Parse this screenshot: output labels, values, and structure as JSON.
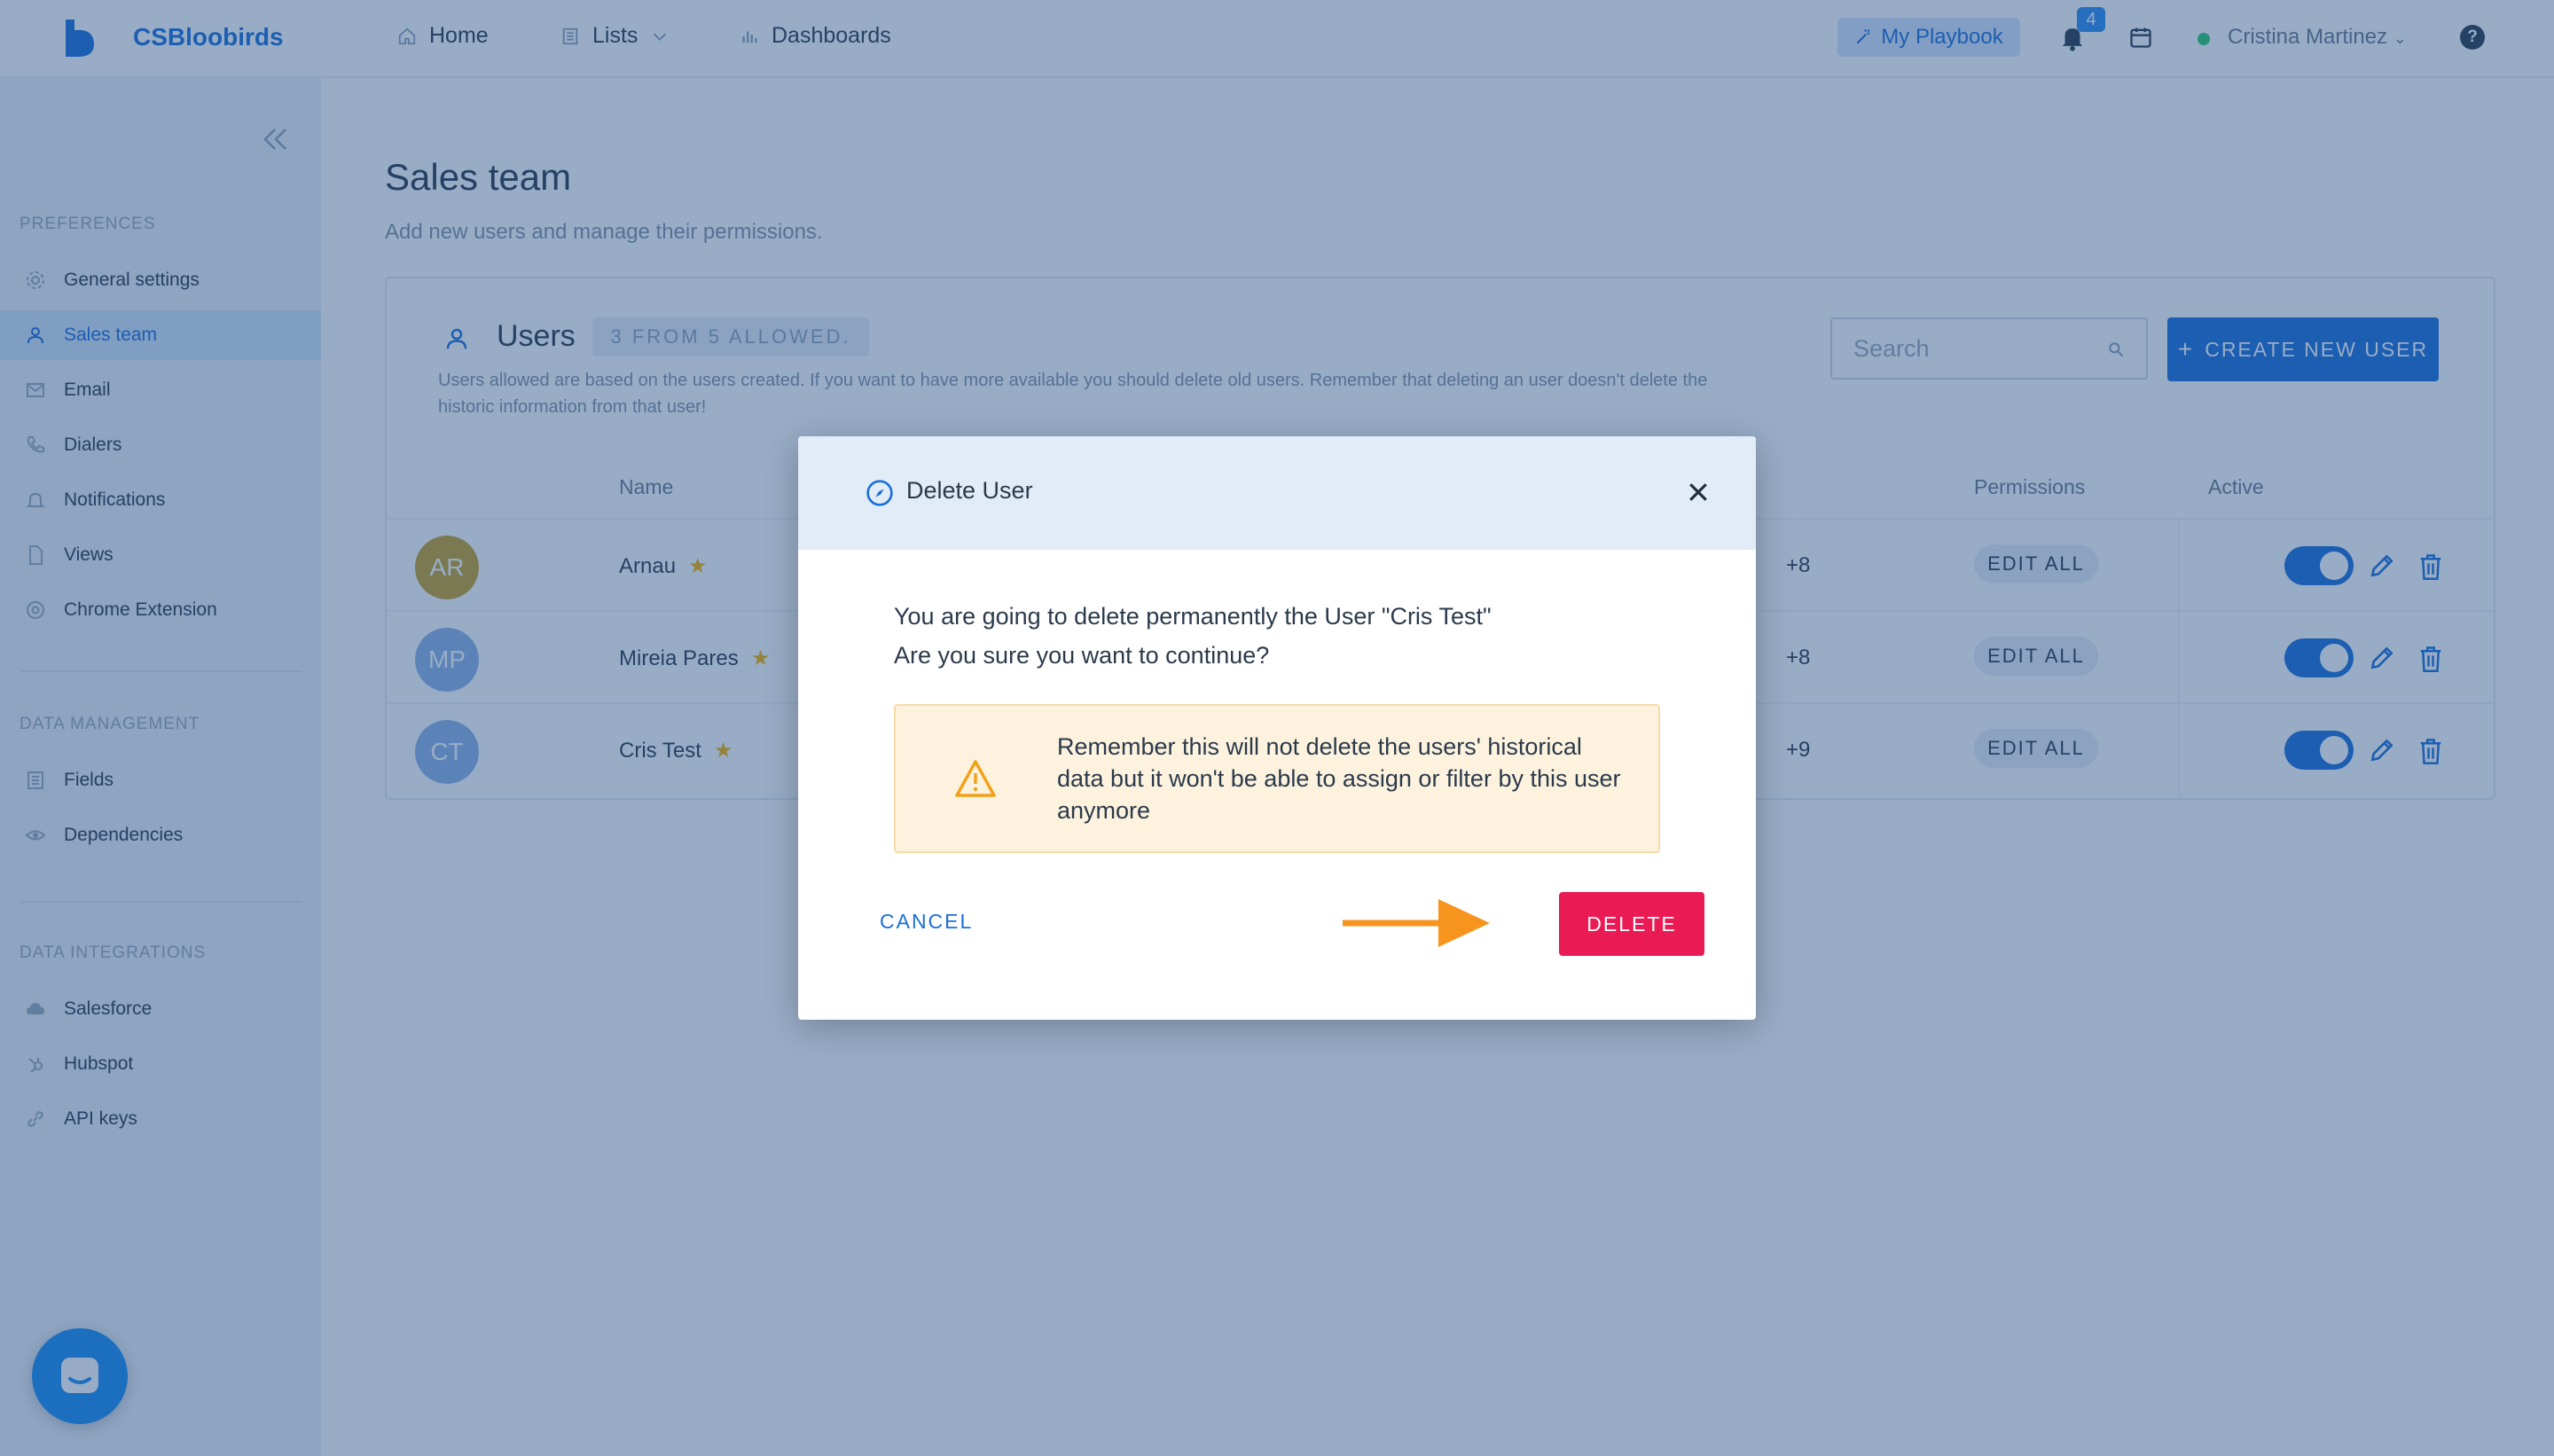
{
  "app": {
    "brand": "CSBloobirds"
  },
  "topnav": {
    "home": "Home",
    "lists": "Lists",
    "dashboards": "Dashboards",
    "playbook": "My Playbook",
    "notifications_count": "4",
    "user_name": "Cristina Martinez",
    "help": "?"
  },
  "sidebar": {
    "preferences_title": "PREFERENCES",
    "preferences": [
      {
        "label": "General settings",
        "icon": "gear-icon"
      },
      {
        "label": "Sales team",
        "icon": "user-icon",
        "active": true
      },
      {
        "label": "Email",
        "icon": "mail-icon"
      },
      {
        "label": "Dialers",
        "icon": "phone-icon"
      },
      {
        "label": "Notifications",
        "icon": "bell-icon"
      },
      {
        "label": "Views",
        "icon": "file-icon"
      },
      {
        "label": "Chrome Extension",
        "icon": "chrome-icon"
      }
    ],
    "data_management_title": "DATA MANAGEMENT",
    "data_management": [
      {
        "label": "Fields",
        "icon": "list-icon"
      },
      {
        "label": "Dependencies",
        "icon": "eye-icon"
      }
    ],
    "data_integrations_title": "DATA INTEGRATIONS",
    "data_integrations": [
      {
        "label": "Salesforce",
        "icon": "cloud-icon"
      },
      {
        "label": "Hubspot",
        "icon": "hubspot-icon"
      },
      {
        "label": "API keys",
        "icon": "link-icon"
      }
    ]
  },
  "page": {
    "title": "Sales team",
    "subtitle": "Add new users and manage their permissions."
  },
  "users": {
    "title": "Users",
    "allowed": "3 FROM 5 ALLOWED.",
    "help_text": "Users allowed are based on the users created. If you want to have more available you should delete old users. Remember that deleting an user doesn't delete the historic information from that user!",
    "search_placeholder": "Search",
    "create_label": "CREATE NEW USER",
    "columns": {
      "name": "Name",
      "permissions": "Permissions",
      "active": "Active"
    },
    "rows": [
      {
        "initials": "AR",
        "name": "Arnau",
        "avatar_color": "#c9a227",
        "more": "+8",
        "permission": "EDIT ALL",
        "active": true
      },
      {
        "initials": "MP",
        "name": "Mireia Pares",
        "avatar_color": "#8fb4e6",
        "more": "+8",
        "permission": "EDIT ALL",
        "active": true
      },
      {
        "initials": "CT",
        "name": "Cris Test",
        "avatar_color": "#8fb4e6",
        "more": "+9",
        "permission": "EDIT ALL",
        "active": true
      }
    ]
  },
  "modal": {
    "title": "Delete User",
    "line1": "You are going to delete permanently the User \"Cris Test\"",
    "line2": "Are you sure you want to continue?",
    "warning": "Remember this will not delete the users' historical data but it won't be able to assign or filter by this user anymore",
    "cancel": "CANCEL",
    "delete": "DELETE"
  },
  "colors": {
    "accent": "#1b6fd8",
    "danger": "#ea1b54",
    "warning_bg": "#fdf2de",
    "arrow": "#f7941d"
  }
}
